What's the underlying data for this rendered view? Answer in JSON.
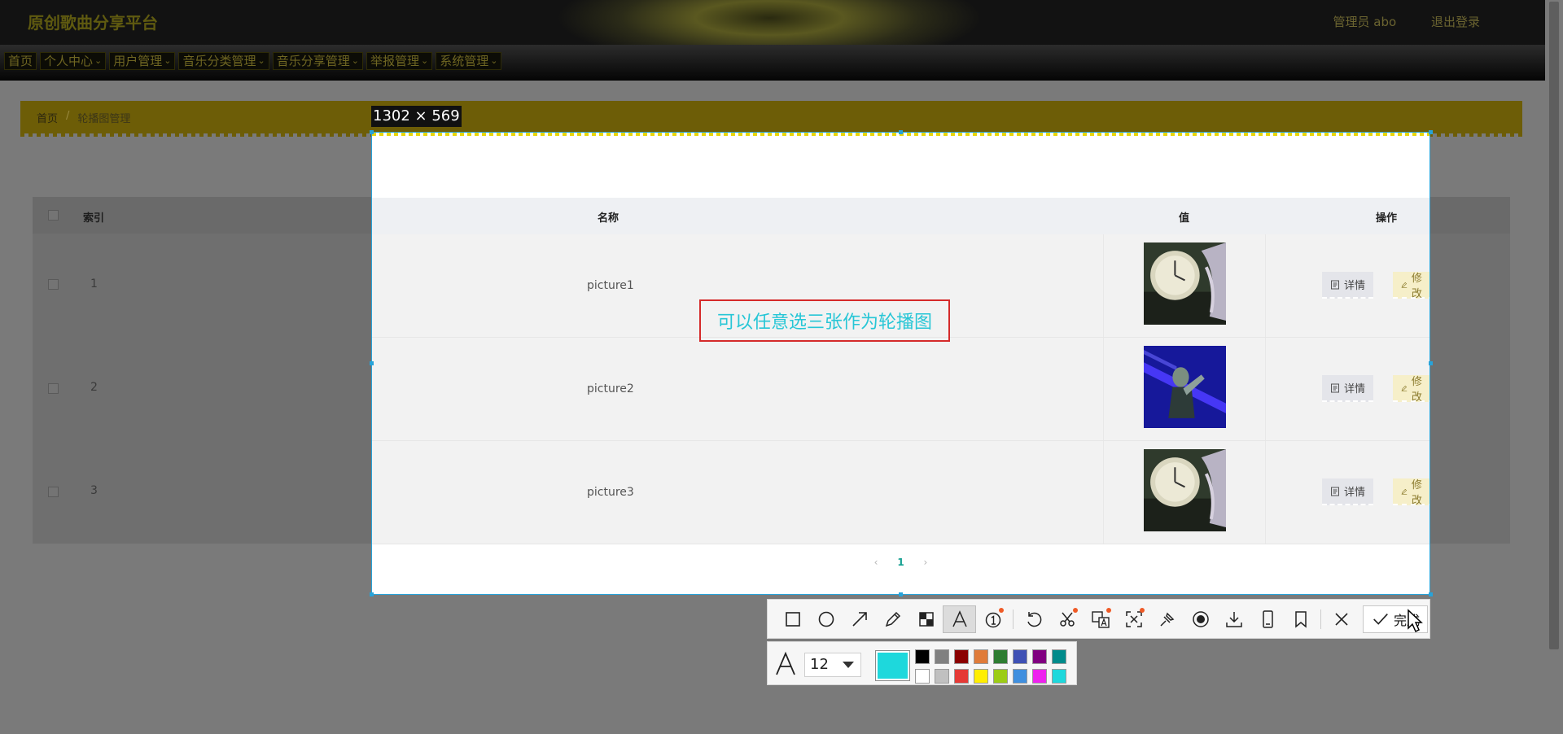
{
  "header": {
    "app_title": "原创歌曲分享平台",
    "user_label": "管理员 abo",
    "logout_label": "退出登录"
  },
  "nav": {
    "items": [
      {
        "label": "首页",
        "has_menu": false
      },
      {
        "label": "个人中心",
        "has_menu": true
      },
      {
        "label": "用户管理",
        "has_menu": true
      },
      {
        "label": "音乐分类管理",
        "has_menu": true
      },
      {
        "label": "音乐分享管理",
        "has_menu": true
      },
      {
        "label": "举报管理",
        "has_menu": true
      },
      {
        "label": "系统管理",
        "has_menu": true
      }
    ]
  },
  "breadcrumb": {
    "home": "首页",
    "separator": "/",
    "current": "轮播图管理"
  },
  "table": {
    "columns": {
      "index": "索引",
      "name": "名称",
      "value": "值",
      "actions": "操作"
    },
    "rows": [
      {
        "index": "1",
        "name": "picture1",
        "thumb": "clock"
      },
      {
        "index": "2",
        "name": "picture2",
        "thumb": "blue-figure"
      },
      {
        "index": "3",
        "name": "picture3",
        "thumb": "clock"
      }
    ],
    "detail_label": "详情",
    "edit_label": "修改"
  },
  "pagination": {
    "prev": "‹",
    "current": "1",
    "next": "›"
  },
  "screenshot_tool": {
    "size_label": "1302 × 569",
    "annotation_text": "可以任意选三张作为轮播图",
    "done_label": "完成",
    "font_size": "12",
    "current_color": "#1ed8dc",
    "palette": [
      "#000000",
      "#808080",
      "#8b0000",
      "#e07b39",
      "#2e7d32",
      "#3f51b5",
      "#800080",
      "#008b8b",
      "#ffffff",
      "#c0c0c0",
      "#e53935",
      "#ffee00",
      "#9ccc15",
      "#3f8fdf",
      "#ee22ee",
      "#1ed8dc"
    ],
    "tools": [
      "rectangle-icon",
      "ellipse-icon",
      "arrow-icon",
      "pencil-icon",
      "mosaic-icon",
      "text-icon",
      "number-marker-icon",
      "undo-icon",
      "scissors-icon",
      "translate-icon",
      "ocr-icon",
      "pin-icon",
      "record-icon",
      "download-icon",
      "phone-icon",
      "bookmark-icon",
      "close-icon"
    ]
  }
}
